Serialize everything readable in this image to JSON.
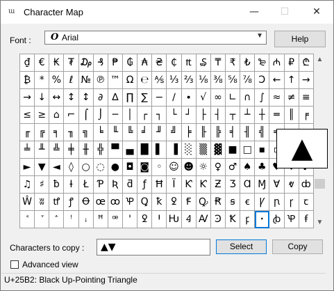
{
  "window": {
    "title": "Character Map",
    "icon_text": "ɯ",
    "controls": {
      "minimize": "—",
      "maximize": "☐",
      "close": "✕"
    }
  },
  "font": {
    "label": "Font :",
    "selected": "Arial",
    "icon_glyph": "O"
  },
  "buttons": {
    "help": "Help",
    "select": "Select",
    "copy": "Copy"
  },
  "grid": {
    "selected_index": 196,
    "rows": [
      [
        "₫",
        "€",
        "₭",
        "₮",
        "₯",
        "₰",
        "₱",
        "₲",
        "₳",
        "₴",
        "₵",
        "₶",
        "₷",
        "₸",
        "₹",
        "₺",
        "₻",
        "₼",
        "₽",
        "₾"
      ],
      [
        "₿",
        "*",
        "%",
        "ℓ",
        "№",
        "℗",
        "™",
        "Ω",
        "℮",
        "⅍",
        "⅓",
        "⅔",
        "⅛",
        "⅜",
        "⅝",
        "⅞",
        "Ↄ",
        "←",
        "↑",
        "→"
      ],
      [
        "→",
        "↓",
        "↔",
        "↕",
        "↕",
        "∂",
        "∆",
        "∏",
        "∑",
        "−",
        "∕",
        "∙",
        "√",
        "∞",
        "∟",
        "∩",
        "∫",
        "≈",
        "≠",
        "≡"
      ],
      [
        "≤",
        "≥",
        "⌂",
        "⌐",
        "⌠",
        "⌡",
        "─",
        "│",
        "┌",
        "┐",
        "└",
        "┘",
        "├",
        "┤",
        "┬",
        "┴",
        "┼",
        "═",
        "║",
        "╒"
      ],
      [
        "╓",
        "╔",
        "╕",
        "╖",
        "╗",
        "╘",
        "╙",
        "╚",
        "╛",
        "╜",
        "╝",
        "╞",
        "╟",
        "╠",
        "╡",
        "╢",
        "╣",
        "╤",
        "╥",
        "╦"
      ],
      [
        "╧",
        "╨",
        "╩",
        "╪",
        "╫",
        "╬",
        "▀",
        "▄",
        "█",
        "▌",
        "▐",
        "░",
        "▒",
        "▓",
        "■",
        "□",
        "▪",
        "▫",
        "▬",
        "▲"
      ],
      [
        "►",
        "▼",
        "◄",
        "◊",
        "○",
        "◌",
        "●",
        "◘",
        "◙",
        "◦",
        "☺",
        "☻",
        "☼",
        "♀",
        "♂",
        "♠",
        "♣",
        "♥",
        "♦",
        "♪"
      ],
      [
        "♫",
        "♯",
        "ƀ",
        "Ɨ",
        "Ł",
        "Ƥ",
        "Ʀ",
        "ƌ",
        "ƒ",
        "Ħ",
        "Ϊ",
        "Ƙ",
        "Ƙ",
        "Ƶ",
        "Ʒ",
        "Ɑ",
        "Ɱ",
        "Ɐ",
        "ⱴ",
        "ȸ"
      ],
      [
        "Ŵ",
        "ʬ",
        "ꝷ",
        "ꝭ",
        "Ꝋ",
        "œ",
        "ꝏ",
        "Ꝕ",
        "Ꝗ",
        "ꝁ",
        "ꝿ",
        "Ꞙ",
        "Ꝙ",
        "Ꞧ",
        "ꞩ",
        "ꞓ",
        "Ꝩ",
        "ꞃ",
        "ꞅ",
        "ꞇ"
      ],
      [
        "ꜗ",
        "ꜘ",
        "ꜙ",
        "ꜝ",
        "ꜟ",
        "ꟸ",
        "ꟹ",
        "ꞌ",
        "ꝿ",
        "Ꞌ",
        "Ƕ",
        "Ꜭ",
        "Ꜹ",
        "Ꜿ",
        "Ꝁ",
        "ꝼ",
        "ꞏ",
        "ꞗ",
        "Ꝕ",
        "ꞙ"
      ]
    ]
  },
  "zoom_char": "▲",
  "copy": {
    "label": "Characters to copy :",
    "value": "▲▼"
  },
  "advanced_view": {
    "label": "Advanced view",
    "checked": false
  },
  "status": "U+25B2: Black Up-Pointing Triangle"
}
